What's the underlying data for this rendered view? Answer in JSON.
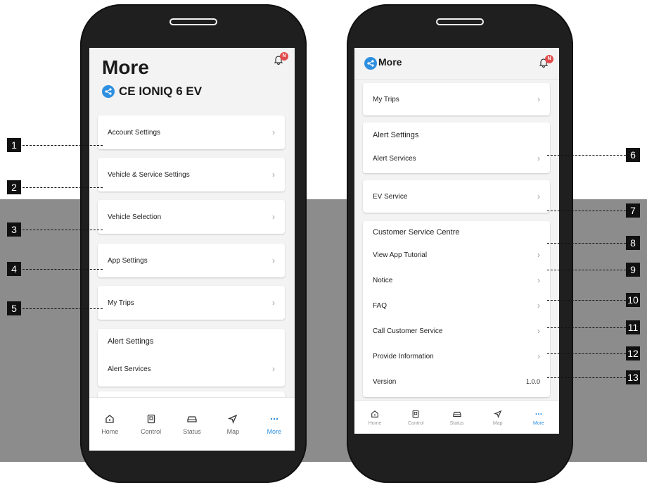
{
  "left_screen": {
    "title": "More",
    "car_name": "CE IONIQ 6 EV",
    "notification_badge": "N",
    "menu": [
      {
        "label": "Account Settings"
      },
      {
        "label": "Vehicle & Service Settings"
      },
      {
        "label": "Vehicle Selection"
      },
      {
        "label": "App Settings"
      },
      {
        "label": "My Trips"
      }
    ],
    "alert_section_title": "Alert Settings",
    "alert_item": "Alert Services"
  },
  "right_screen": {
    "title": "More",
    "notification_badge": "N",
    "my_trips": "My Trips",
    "alert_section_title": "Alert Settings",
    "alert_item": "Alert Services",
    "ev_service": "EV Service",
    "customer_section_title": "Customer Service Centre",
    "customer_items": [
      {
        "label": "View App Tutorial"
      },
      {
        "label": "Notice"
      },
      {
        "label": "FAQ"
      },
      {
        "label": "Call Customer Service"
      },
      {
        "label": "Provide Information"
      }
    ],
    "version_label": "Version",
    "version_value": "1.0.0"
  },
  "nav": [
    {
      "label": "Home",
      "icon": "home-icon"
    },
    {
      "label": "Control",
      "icon": "remote-icon"
    },
    {
      "label": "Status",
      "icon": "car-icon"
    },
    {
      "label": "Map",
      "icon": "navigation-arrow-icon"
    },
    {
      "label": "More",
      "icon": "more-dots-icon",
      "active": true
    }
  ],
  "callouts": [
    "1",
    "2",
    "3",
    "4",
    "5",
    "6",
    "7",
    "8",
    "9",
    "10",
    "11",
    "12",
    "13"
  ],
  "colors": {
    "accent": "#2f8fe0",
    "badge": "#e04b4b",
    "grey_band": "#8c8c8c",
    "phone_body": "#1f1f1f"
  }
}
